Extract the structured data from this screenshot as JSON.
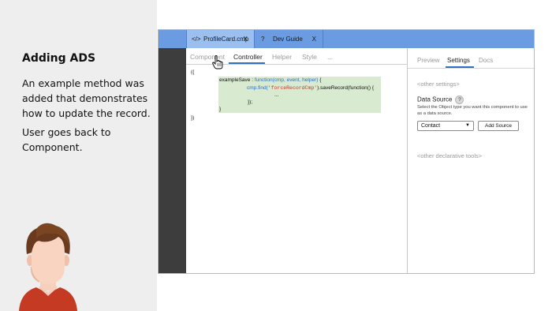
{
  "narrative": {
    "title": "Adding ADS",
    "paragraph1": "An example method was added that demonstrates how to update the record.",
    "paragraph2": "User goes back to Component."
  },
  "window": {
    "file_tabs": [
      {
        "icon": "</>",
        "label": "ProfileCard.cmp",
        "close": "X"
      },
      {
        "icon": "?",
        "label": "Dev Guide",
        "close": "X"
      }
    ],
    "editor_tabs": [
      "Component",
      "Controller",
      "Helper",
      "Style",
      "..."
    ],
    "active_editor_tab": "Controller",
    "code": {
      "line1": "({",
      "l2_method": "exampleSave",
      "l2_sep": " : ",
      "l2_fn": "function",
      "l2_params": "(cmp, event, helper)",
      "l2_end": " {",
      "l3_call": "cmp.find(",
      "l3_str": "'forceRecordCmp'",
      "l3_rest": ").saveRecord(function() {",
      "l4": "...",
      "l5": "});",
      "l6": "}",
      "line7": "})"
    },
    "panel": {
      "tabs": [
        "Preview",
        "Settings",
        "Docs"
      ],
      "active_tab": "Settings",
      "other_settings": "<other settings>",
      "data_source_title": "Data Source",
      "help_icon": "?",
      "data_source_desc": "Select the Object type you want this component to use as a data source.",
      "select_value": "Contact",
      "add_source_label": "Add Source",
      "other_tools": "<other declarative tools>"
    }
  },
  "colors": {
    "tabbar": "#6b9be0",
    "active_tab": "#9bbfef",
    "gutter": "#3d3d3d",
    "code_highlight": "#d8ead0",
    "accent": "#2f6fc4"
  }
}
